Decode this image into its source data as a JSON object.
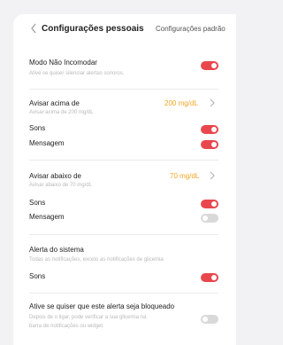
{
  "header": {
    "title": "Configurações pessoais",
    "defaults_label": "Configurações padrão"
  },
  "silent_mode": {
    "label": "Modo Não Incomodar",
    "description": "Ative se quiser silenciar alertas sonoros.",
    "enabled": true
  },
  "high_alert": {
    "label": "Avisar acima de",
    "description": "Avisar acima de 200 mg/dL",
    "value": "200 mg/dL",
    "sounds_label": "Sons",
    "sounds_enabled": true,
    "message_label": "Mensagem",
    "message_enabled": true
  },
  "low_alert": {
    "label": "Avisar abaixo de",
    "description": "Avisar abaixo de 70 mg/dL",
    "value": "70 mg/dL",
    "sounds_label": "Sons",
    "sounds_enabled": true,
    "message_label": "Mensagem",
    "message_enabled": false
  },
  "system_alert": {
    "label": "Alerta do sistema",
    "description": "Todas as notificações, exceto as notificações de glicemia",
    "sounds_label": "Sons",
    "sounds_enabled": true
  },
  "locked_alert": {
    "label": "Ative se quiser que este alerta seja bloqueado",
    "description_line1": "Depois de o ligar, pode verificar a sua glicemia na",
    "description_line2": "barra de notificações ou widget.",
    "enabled": false
  },
  "colors": {
    "accent_red": "#e8474d",
    "value_orange": "#f5a623",
    "toggle_off": "#d9d9d9"
  }
}
